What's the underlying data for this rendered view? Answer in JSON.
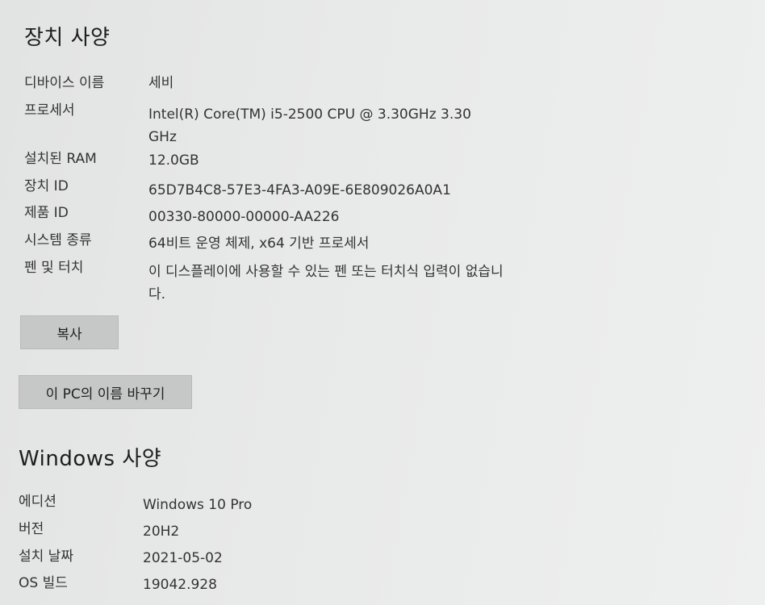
{
  "device_specs": {
    "title": "장치 사양",
    "rows": [
      {
        "label": "디바이스 이름",
        "value": "세비"
      },
      {
        "label": "프로세서",
        "value": "Intel(R) Core(TM) i5-2500 CPU @ 3.30GHz   3.30 GHz"
      },
      {
        "label": "설치된 RAM",
        "value": "12.0GB"
      },
      {
        "label": "장치 ID",
        "value": "65D7B4C8-57E3-4FA3-A09E-6E809026A0A1"
      },
      {
        "label": "제품 ID",
        "value": "00330-80000-00000-AA226"
      },
      {
        "label": "시스템 종류",
        "value": "64비트 운영 체제, x64 기반 프로세서"
      },
      {
        "label": "펜 및 터치",
        "value": "이 디스플레이에 사용할 수 있는 펜 또는 터치식 입력이 없습니다."
      }
    ],
    "copy_button": "복사",
    "rename_button": "이 PC의 이름 바꾸기"
  },
  "windows_specs": {
    "title": "Windows 사양",
    "rows": [
      {
        "label": "에디션",
        "value": "Windows 10 Pro"
      },
      {
        "label": "버전",
        "value": "20H2"
      },
      {
        "label": "설치 날짜",
        "value": "2021-05-02"
      },
      {
        "label": "OS 빌드",
        "value": "19042.928"
      }
    ]
  }
}
